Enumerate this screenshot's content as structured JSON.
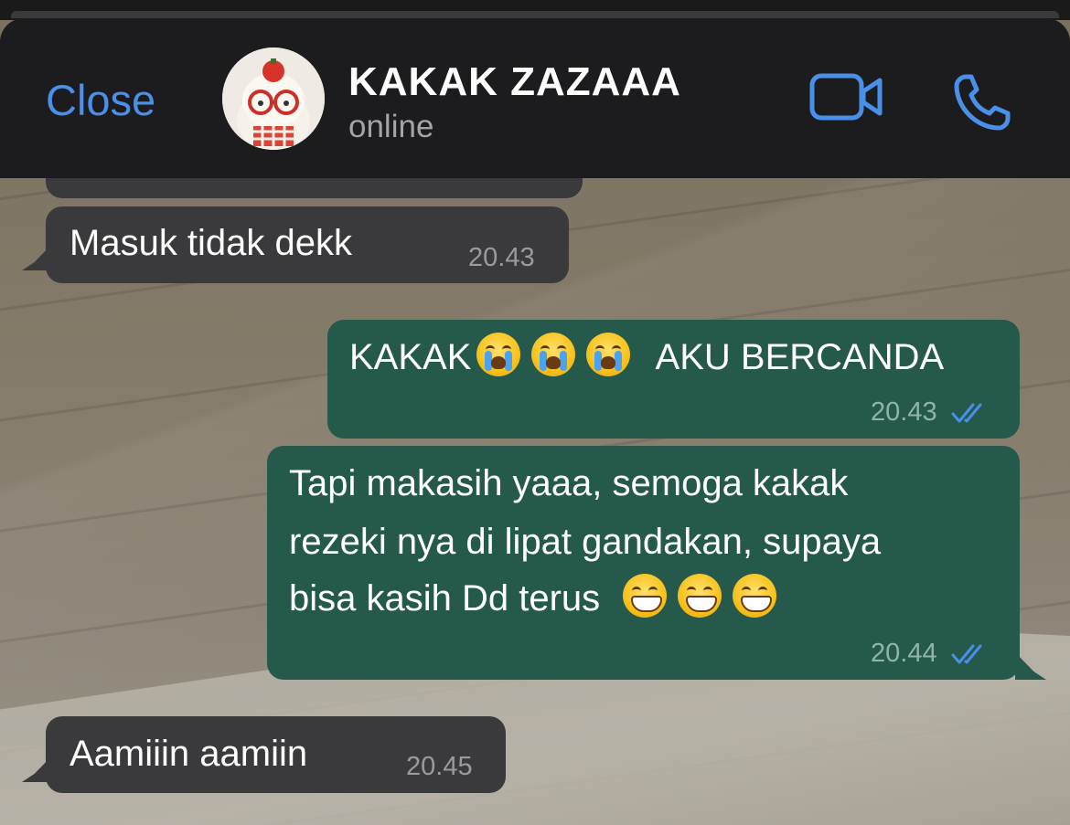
{
  "header": {
    "close_label": "Close",
    "contact_name": "KAKAK ZAZAAA",
    "status": "online",
    "video_icon": "video-camera-icon",
    "call_icon": "phone-icon",
    "accent_color": "#4a8fe8"
  },
  "messages": [
    {
      "direction": "incoming",
      "text": "Masuk tidak dekk",
      "time": "20.43"
    },
    {
      "direction": "outgoing",
      "text": "KAKAK",
      "text_after": "AKU BERCANDA",
      "emoji": [
        "loudly-crying-face",
        "loudly-crying-face",
        "loudly-crying-face"
      ],
      "time": "20.43",
      "status": "read"
    },
    {
      "direction": "outgoing",
      "lines": [
        "Tapi makasih yaaa, semoga kakak",
        "rezeki nya di lipat gandakan, supaya",
        "bisa kasih Dd terus"
      ],
      "emoji": [
        "grinning-face",
        "grinning-face",
        "grinning-face"
      ],
      "time": "20.44",
      "status": "read"
    },
    {
      "direction": "incoming",
      "text": "Aamiiin aamiin",
      "time": "20.45"
    }
  ],
  "colors": {
    "incoming_bubble": "#3a3a3c",
    "outgoing_bubble": "#24594c",
    "header_bg": "#1c1c1e",
    "read_check": "#4a8fe8"
  }
}
